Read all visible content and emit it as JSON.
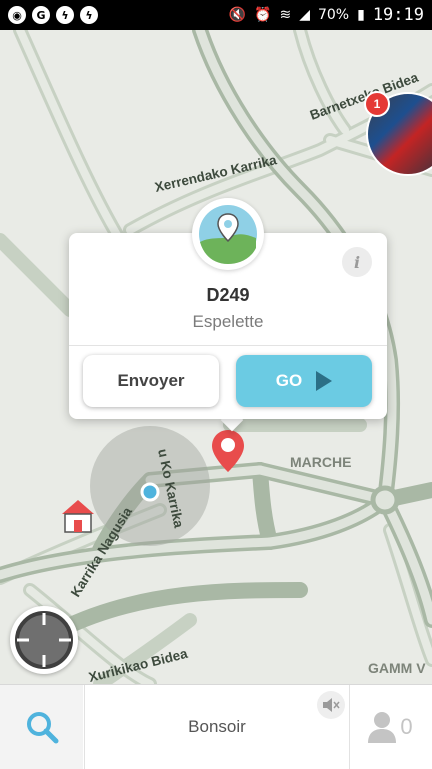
{
  "status_bar": {
    "battery": "70%",
    "time": "19:19",
    "left_icons": [
      "maps-pin-icon",
      "chat-bubble-icon",
      "messenger-icon",
      "messenger-icon"
    ],
    "right_icons": [
      "mute-icon",
      "alarm-icon",
      "wifi-icon",
      "signal-icon",
      "battery-charging-icon"
    ]
  },
  "map": {
    "street_labels": [
      "Barnetxeko Bidea",
      "Xerrendako Karrika",
      "Karrika Nagusia",
      "u Ko Karrika",
      "Xurikikao Bidea"
    ],
    "area_labels": [
      "MARCHE",
      "GAMM V"
    ],
    "colors": {
      "background": "#e9ebe6",
      "road_main": "#a9b8a5",
      "road_secondary": "#c5cfc1",
      "road_fill": "#dfe4dc"
    }
  },
  "friend_avatar": {
    "badge_count": "1"
  },
  "destination_popup": {
    "title": "D249",
    "subtitle": "Espelette",
    "send_label": "Envoyer",
    "go_label": "GO",
    "info_label": "i"
  },
  "bottom_bar": {
    "greeting": "Bonsoir",
    "users_count": "0"
  },
  "colors": {
    "accent": "#6bcbe3",
    "accent_dark": "#2b6f86",
    "pin_red": "#e84c4c",
    "location_blue": "#4fb3dd",
    "badge_red": "#e53935"
  }
}
